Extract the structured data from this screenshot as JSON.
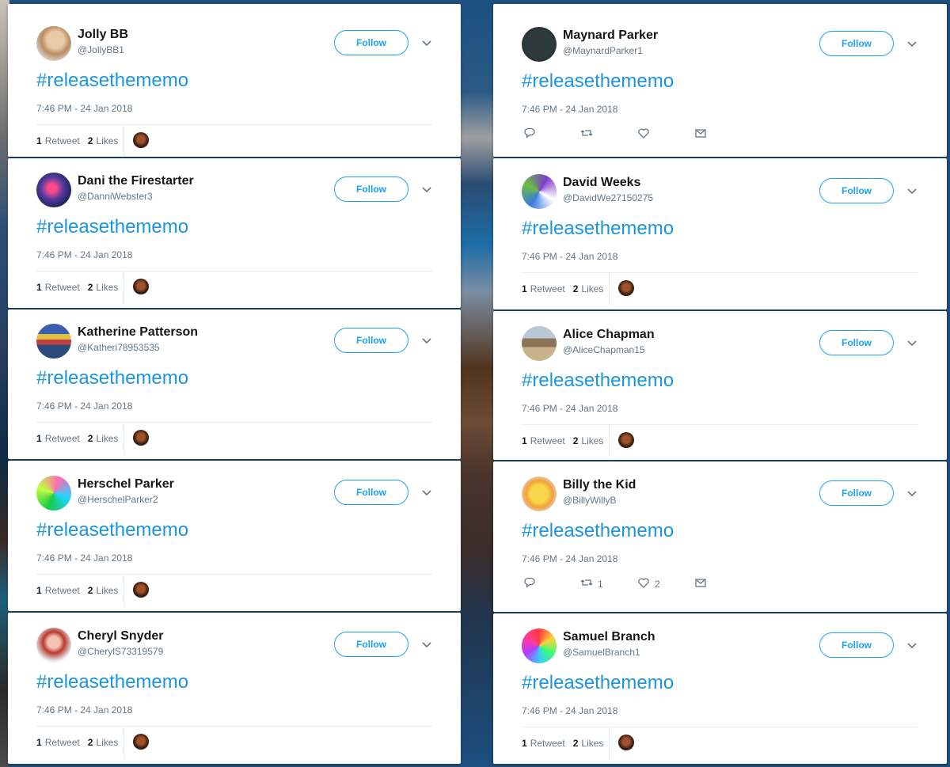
{
  "labels": {
    "follow": "Follow",
    "retweet": "Retweet",
    "likes": "Likes"
  },
  "colors": {
    "accent": "#1da1f2",
    "hashtag": "#1b95e0",
    "secondary_text": "#657786"
  },
  "tweets": [
    {
      "name": "Jolly BB",
      "handle": "@JollyBB1",
      "text": "#releasethememo",
      "timestamp": "7:46 PM - 24 Jan 2018",
      "retweets": "1",
      "likes": "2"
    },
    {
      "name": "Maynard Parker",
      "handle": "@MaynardParker1",
      "text": "#releasethememo",
      "timestamp": "7:46 PM - 24 Jan 2018",
      "retweets": "",
      "likes": ""
    },
    {
      "name": "Dani the Firestarter",
      "handle": "@DanniWebster3",
      "text": "#releasethememo",
      "timestamp": "7:46 PM - 24 Jan 2018",
      "retweets": "1",
      "likes": "2"
    },
    {
      "name": "David Weeks",
      "handle": "@DavidWe27150275",
      "text": "#releasethememo",
      "timestamp": "7:46 PM - 24 Jan 2018",
      "retweets": "1",
      "likes": "2"
    },
    {
      "name": "Katherine Patterson",
      "handle": "@Katheri78953535",
      "text": "#releasethememo",
      "timestamp": "7:46 PM - 24 Jan 2018",
      "retweets": "1",
      "likes": "2"
    },
    {
      "name": "Alice Chapman",
      "handle": "@AliceChapman15",
      "text": "#releasethememo",
      "timestamp": "7:46 PM - 24 Jan 2018",
      "retweets": "1",
      "likes": "2"
    },
    {
      "name": "Herschel Parker",
      "handle": "@HerschelParker2",
      "text": "#releasethememo",
      "timestamp": "7:46 PM - 24 Jan 2018",
      "retweets": "1",
      "likes": "2"
    },
    {
      "name": "Billy the Kid",
      "handle": "@BillyWillyB",
      "text": "#releasethememo",
      "timestamp": "7:46 PM - 24 Jan 2018",
      "retweets": "",
      "likes": "",
      "action_retweets": "1",
      "action_likes": "2"
    },
    {
      "name": "Cheryl Snyder",
      "handle": "@CherylS73319579",
      "text": "#releasethememo",
      "timestamp": "7:46 PM - 24 Jan 2018",
      "retweets": "1",
      "likes": "2"
    },
    {
      "name": "Samuel Branch",
      "handle": "@SamuelBranch1",
      "text": "#releasethememo",
      "timestamp": "7:46 PM - 24 Jan 2018",
      "retweets": "1",
      "likes": "2"
    }
  ],
  "avatar_images": {
    "0": "portrait-man",
    "1": "quote-text-image",
    "2": "jellyfish",
    "3": "purple-abstract",
    "4": "shelves",
    "5": "beach-scene",
    "6": "green-lights",
    "7": "yellow-cartoon",
    "8": "red-hair-woman",
    "9": "colorful-balls"
  }
}
